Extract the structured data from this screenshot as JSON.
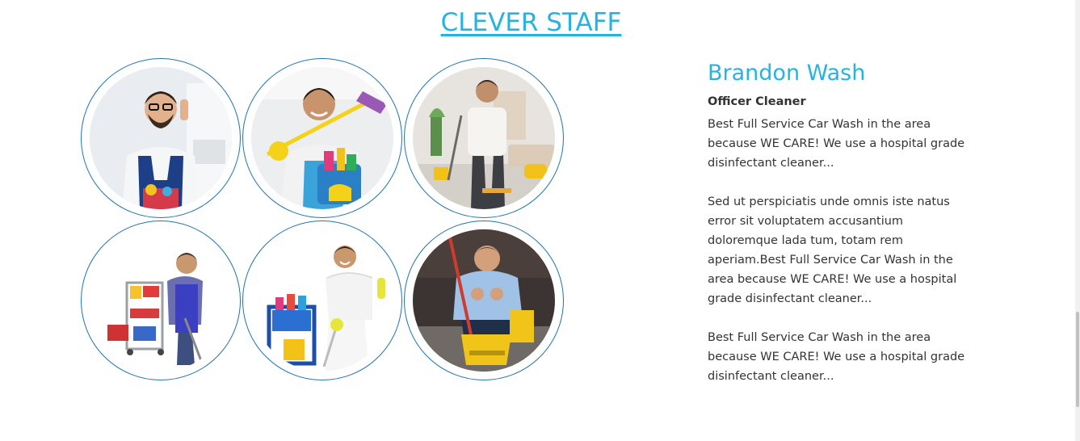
{
  "section": {
    "title": "CLEVER STAFF"
  },
  "staff": [
    {
      "photo_icon": "cleaner-with-glasses-photo"
    },
    {
      "photo_icon": "cleaner-with-bucket-photo"
    },
    {
      "photo_icon": "cleaner-mopping-livingroom-photo"
    },
    {
      "photo_icon": "cleaner-with-cart-photo"
    },
    {
      "photo_icon": "cleaner-with-trolley-photo"
    },
    {
      "photo_icon": "cleaner-with-mop-bucket-photo"
    }
  ],
  "selected_member": {
    "name": "Brandon Wash",
    "role": "Officer Cleaner",
    "paragraphs": [
      "Best Full Service Car Wash in the area because WE CARE! We use a hospital grade disinfectant cleaner...",
      "Sed ut perspiciatis unde omnis iste natus error sit voluptatem accusantium doloremque lada tum, totam rem aperiam.Best Full Service Car Wash in the area because WE CARE! We use a hospital grade disinfectant cleaner...",
      "Best Full Service Car Wash in the area because WE CARE! We use a hospital grade disinfectant cleaner..."
    ]
  },
  "colors": {
    "accent": "#25b3e3",
    "ring": "#1f74ad",
    "text": "#333333"
  }
}
